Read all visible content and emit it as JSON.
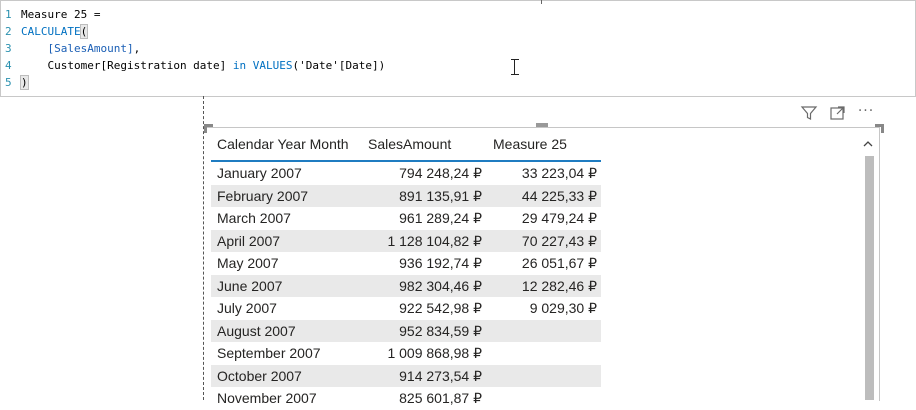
{
  "formula": {
    "lines": [
      {
        "num": "1",
        "parts": [
          {
            "t": "Measure 25 =",
            "c": "plain"
          }
        ]
      },
      {
        "num": "2",
        "parts": [
          {
            "t": "CALCULATE",
            "c": "kw"
          },
          {
            "t": "(",
            "c": "brk"
          }
        ]
      },
      {
        "num": "3",
        "parts": [
          {
            "t": "    ",
            "c": "plain"
          },
          {
            "t": "[SalesAmount]",
            "c": "meas"
          },
          {
            "t": ",",
            "c": "plain"
          }
        ]
      },
      {
        "num": "4",
        "parts": [
          {
            "t": "    Customer[Registration date] ",
            "c": "plain"
          },
          {
            "t": "in",
            "c": "kw"
          },
          {
            "t": " ",
            "c": "plain"
          },
          {
            "t": "VALUES",
            "c": "kw"
          },
          {
            "t": "('Date'[Date])",
            "c": "plain"
          }
        ]
      },
      {
        "num": "5",
        "parts": [
          {
            "t": ")",
            "c": "brk"
          }
        ]
      }
    ]
  },
  "visual_header": {
    "icons": [
      "filter-icon",
      "focus-mode-icon",
      "more-options-icon"
    ],
    "more_glyph": "···"
  },
  "table": {
    "columns": [
      "Calendar Year Month",
      "SalesAmount",
      "Measure 25"
    ],
    "rows": [
      {
        "month": "January 2007",
        "sales": "794 248,24 ₽",
        "measure": "33 223,04 ₽"
      },
      {
        "month": "February 2007",
        "sales": "891 135,91 ₽",
        "measure": "44 225,33 ₽"
      },
      {
        "month": "March 2007",
        "sales": "961 289,24 ₽",
        "measure": "29 479,24 ₽"
      },
      {
        "month": "April 2007",
        "sales": "1 128 104,82 ₽",
        "measure": "70 227,43 ₽"
      },
      {
        "month": "May 2007",
        "sales": "936 192,74 ₽",
        "measure": "26 051,67 ₽"
      },
      {
        "month": "June 2007",
        "sales": "982 304,46 ₽",
        "measure": "12 282,46 ₽"
      },
      {
        "month": "July 2007",
        "sales": "922 542,98 ₽",
        "measure": "9 029,30 ₽"
      },
      {
        "month": "August 2007",
        "sales": "952 834,59 ₽",
        "measure": ""
      },
      {
        "month": "September 2007",
        "sales": "1 009 868,98 ₽",
        "measure": ""
      },
      {
        "month": "October 2007",
        "sales": "914 273,54 ₽",
        "measure": ""
      },
      {
        "month": "November 2007",
        "sales": "825 601,87 ₽",
        "measure": ""
      }
    ]
  },
  "colors": {
    "header_underline": "#1f7cc1",
    "row_alt": "#e9e9e9",
    "keyword": "#0070c1",
    "line_number": "#2b91af"
  }
}
